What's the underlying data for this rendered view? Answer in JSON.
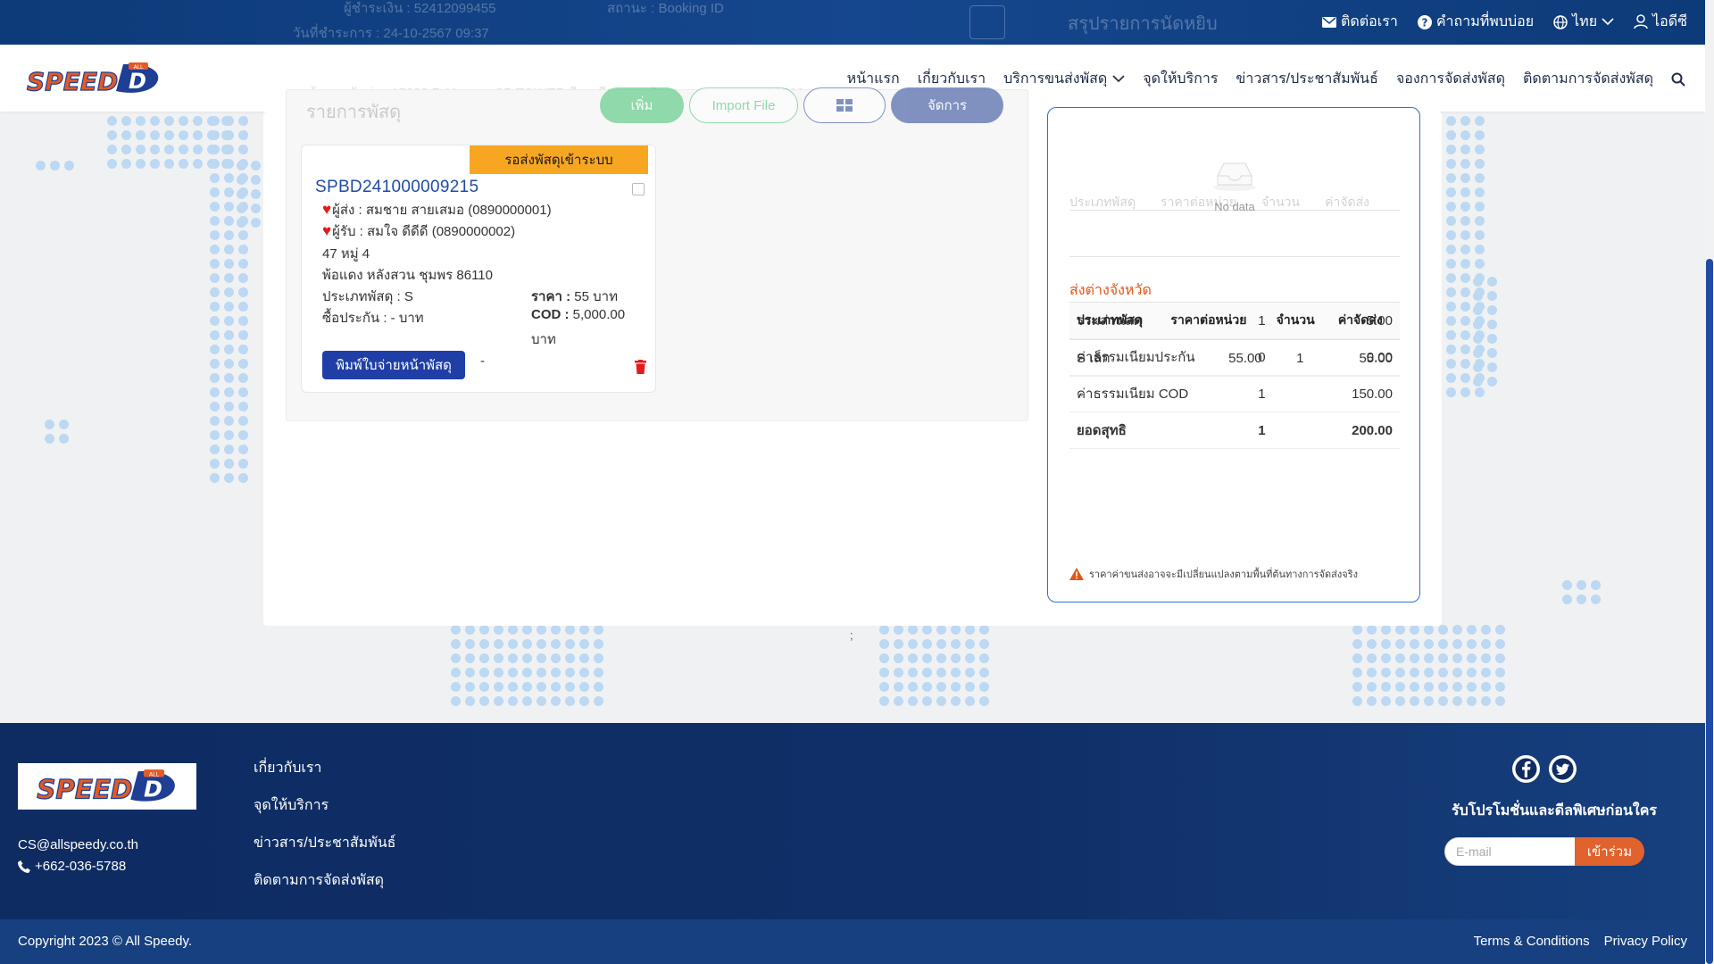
{
  "topbar": {
    "ghost_lines": [
      "ผู้ชำระเงิน : 52412099455",
      "สถานะ : Booking ID",
      "วันที่ชำระการ : 24-10-2567 09:37",
      "ต้นทางจัดส่ง : 15888 7-11 สาขาCP TOWER สีลม สีลม บางรัก กรุงเทพมหานคร 10500"
    ],
    "contact": "ติดต่อเรา",
    "faq": "คำถามที่พบบ่อย",
    "language": "ไทย",
    "user": "ไอดีซี"
  },
  "nav": {
    "items": [
      "หน้าแรก",
      "เกี่ยวกับเรา",
      "บริการขนส่งพัสดุ",
      "จุดให้บริการ",
      "ข่าวสาร/ประชาสัมพันธ์",
      "จองการจัดส่งพัสดุ",
      "ติดตามการจัดส่งพัสดุ"
    ]
  },
  "logo": {
    "text": "SPEED",
    "d": "D",
    "sub": "ALL"
  },
  "parcel_list": {
    "header": "รายการพัสดุ",
    "ghost_buttons": [
      "เพิ่ม",
      "Import File",
      "จัดการ"
    ]
  },
  "card": {
    "status": "รอส่งพัสดุเข้าระบบ",
    "tracking": "SPBD241000009215",
    "sender_label": "ผู้ส่ง :",
    "sender": "สมชาย สายเสมอ",
    "sender_phone": "(0890000001)",
    "receiver_label": "ผู้รับ :",
    "receiver": "สมใจ ดีดีดี",
    "receiver_phone": "(0890000002)",
    "address1": "47 หมู่ 4",
    "address2": "พ้อแดง หลังสวน ชุมพร 86110",
    "type_label": "ประเภทพัสดุ :",
    "type": "S",
    "price_label": "ราคา :",
    "price": "55 บาท",
    "insure_label": "ซื้อประกัน :",
    "insure": "- บาท",
    "cod_label": "COD :",
    "cod": "5,000.00",
    "cod_unit": "บาท",
    "print_button": "พิมพ์ใบจ่ายหน้าพัสดุ",
    "dash": "-"
  },
  "summary": {
    "title": "สรุปรายการนัดหยิบ",
    "ghost_headers": [
      "ประเภทพัสดุ",
      "ราคาต่อหน่วย",
      "จำนวน",
      "ค่าจัดส่ง"
    ],
    "no_data": "No data",
    "section": "ส่งต่างจังหวัด",
    "headers": [
      "ประเภทพัสดุ",
      "ราคาต่อหน่วย",
      "จำนวน",
      "ค่าจัดส่ง"
    ],
    "rows": [
      [
        "S เล็ก",
        "55.00",
        "1",
        "55.00"
      ]
    ],
    "totals": [
      [
        "รวมส่วนลด",
        "1",
        "5.00"
      ],
      [
        "ค่าธรรมเนียมประกัน",
        "0",
        "0.00"
      ],
      [
        "ค่าธรรมเนียม COD",
        "1",
        "150.00"
      ],
      [
        "ยอดสุทธิ",
        "1",
        "200.00"
      ]
    ],
    "note": "ราคาค่าขนส่งอาจจะมีเปลี่ยนแปลงตามพื้นที่ต้นทางการจัดส่งจริง"
  },
  "semicolon": ";",
  "footer": {
    "email": "CS@allspeedy.co.th",
    "phone": "+662-036-5788",
    "links": [
      "เกี่ยวกับเรา",
      "จุดให้บริการ",
      "ข่าวสาร/ประชาสัมพันธ์",
      "ติดตามการจัดส่งพัสดุ"
    ],
    "promo": "รับโปรโมชั่นและดีลพิเศษก่อนใคร",
    "email_placeholder": "E-mail",
    "join": "เข้าร่วม",
    "copyright": "Copyright 2023 © All Speedy.",
    "terms": "Terms & Conditions",
    "privacy": "Privacy Policy"
  },
  "colors": {
    "primary": "#1f4ba5",
    "badge": "#f7a622",
    "accent": "#e0561b",
    "footer": "#0e2c62"
  }
}
